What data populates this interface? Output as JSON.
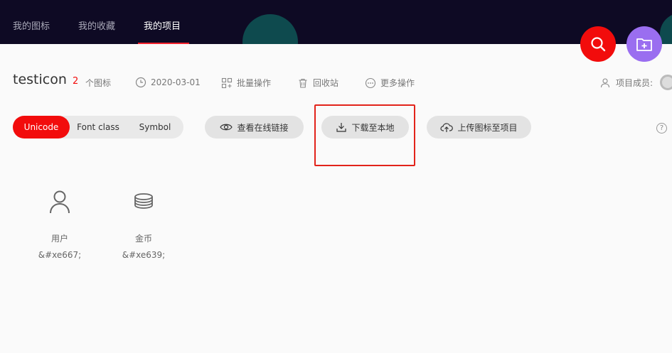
{
  "nav": {
    "tabs": [
      {
        "label": "我的图标"
      },
      {
        "label": "我的收藏"
      },
      {
        "label": "我的项目",
        "active": true
      }
    ]
  },
  "fabs": {
    "search_icon": "search-icon",
    "new_project_icon": "folder-plus-icon"
  },
  "project": {
    "title": "testicon",
    "count": "2",
    "count_suffix": "个图标",
    "date": "2020-03-01",
    "batch_label": "批量操作",
    "trash_label": "回收站",
    "more_label": "更多操作",
    "members_label": "项目成员:"
  },
  "modes": {
    "options": [
      "Unicode",
      "Font class",
      "Symbol"
    ],
    "selected": "Unicode"
  },
  "actions": {
    "view_online": "查看在线链接",
    "download": "下载至本地",
    "upload": "上传图标至项目"
  },
  "help": "?",
  "icons": [
    {
      "name": "用户",
      "code": "&#xe667;",
      "icon": "user-icon"
    },
    {
      "name": "金币",
      "code": "&#xe639;",
      "icon": "coins-icon"
    }
  ],
  "colors": {
    "accent": "#f20c0c",
    "purple": "#9a6ef0",
    "nav_bg": "#0e0a24"
  }
}
